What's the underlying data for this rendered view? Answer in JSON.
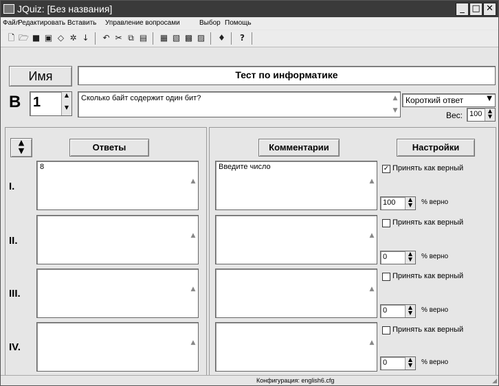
{
  "window": {
    "title": "JQuiz: [Без названия]"
  },
  "menu": [
    "Файл",
    "Редактировать",
    "Вставить",
    "Управление вопросами",
    "Выбор",
    "Помощь"
  ],
  "toolbar_icons": [
    "new-file-icon",
    "open-folder-icon",
    "save-icon",
    "save-as-icon",
    "eraser-icon",
    "web-export-icon",
    "down-arrow-icon",
    "undo-icon",
    "cut-icon",
    "copy-icon",
    "paste-icon",
    "add-question-icon",
    "insert-picture-icon",
    "web-page-icon",
    "web-page-alt-icon",
    "help-book-icon",
    "help-icon"
  ],
  "header": {
    "name_button": "Имя",
    "quiz_title": "Тест по информатике"
  },
  "question": {
    "letter": "В",
    "number": "1",
    "text": "Сколько байт содержит один бит?",
    "type_selected": "Короткий ответ",
    "weight_label": "Вес:",
    "weight_value": "100"
  },
  "columns": {
    "answers": "Ответы",
    "comments": "Комментарии",
    "settings": "Настройки"
  },
  "answers": [
    {
      "label": "I.",
      "text": "8",
      "comment": "Введите число",
      "correct": true,
      "correct_label": "Принять как верный",
      "percent": "100",
      "percent_label": "% верно"
    },
    {
      "label": "II.",
      "text": "",
      "comment": "",
      "correct": false,
      "correct_label": "Принять как верный",
      "percent": "0",
      "percent_label": "% верно"
    },
    {
      "label": "III.",
      "text": "",
      "comment": "",
      "correct": false,
      "correct_label": "Принять как верный",
      "percent": "0",
      "percent_label": "% верно"
    },
    {
      "label": "IV.",
      "text": "",
      "comment": "",
      "correct": false,
      "correct_label": "Принять как верный",
      "percent": "0",
      "percent_label": "% верно"
    }
  ],
  "status": {
    "config": "Конфигурация: english6.cfg"
  }
}
